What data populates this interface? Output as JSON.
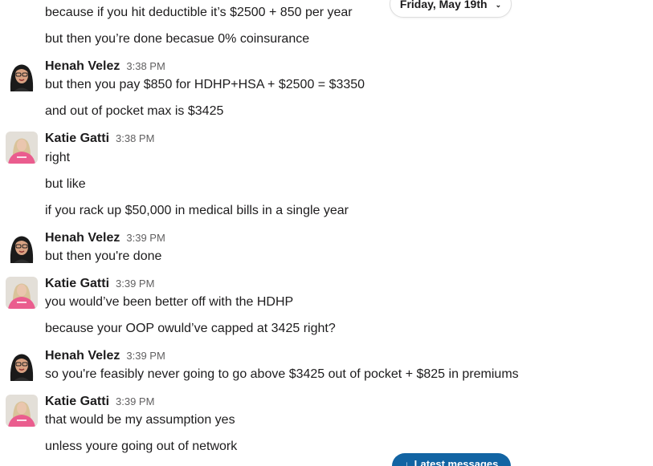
{
  "date_divider": {
    "label": "Friday, May 19th",
    "icon": "chevron-down-icon"
  },
  "latest_button": {
    "label": "Latest messages",
    "icon": "arrow-down-icon",
    "color": "#1264a3"
  },
  "messages": [
    {
      "text": "because if you hit deductible it’s $2500 + 850 per year"
    },
    {
      "text": "but then you’re done becasue 0% coinsurance"
    },
    {
      "author": "Henah Velez",
      "time": "3:38 PM",
      "text": "but then you pay $850 for HDHP+HSA + $2500 = $3350"
    },
    {
      "text": "and out of pocket max is $3425"
    },
    {
      "author": "Katie Gatti",
      "time": "3:38 PM",
      "text": "right"
    },
    {
      "text": "but like"
    },
    {
      "text": "if you rack up $50,000 in medical bills in a single year"
    },
    {
      "author": "Henah Velez",
      "time": "3:39 PM",
      "text": "but then you're done"
    },
    {
      "author": "Katie Gatti",
      "time": "3:39 PM",
      "text": "you would’ve been better off with the HDHP"
    },
    {
      "text": "because your OOP owuld’ve capped at 3425 right?"
    },
    {
      "author": "Henah Velez",
      "time": "3:39 PM",
      "text": "so you're feasibly never going to go above $3425 out of pocket + $825 in premiums"
    },
    {
      "author": "Katie Gatti",
      "time": "3:39 PM",
      "text": "that would be my assumption yes"
    },
    {
      "text": "unless youre going out of network"
    }
  ]
}
